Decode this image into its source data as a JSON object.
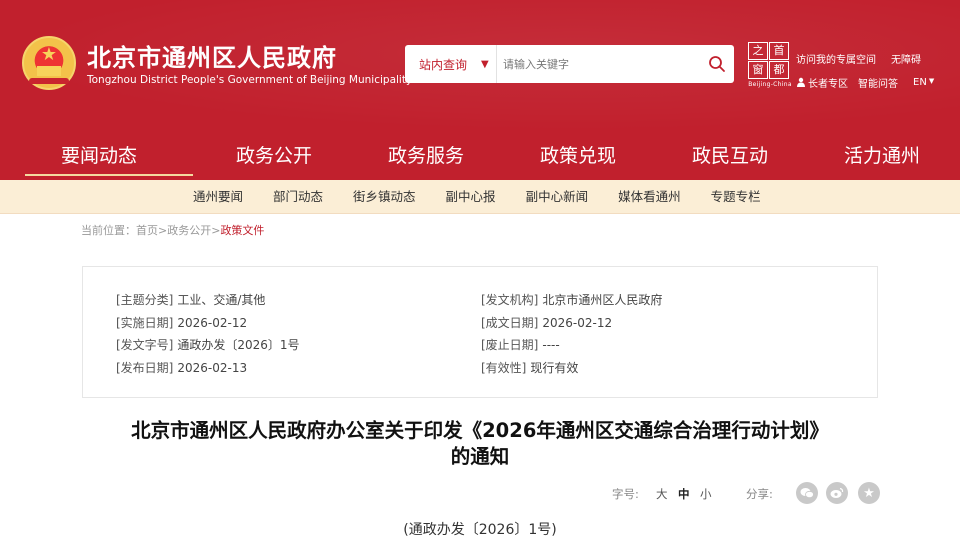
{
  "header": {
    "title": "北京市通州区人民政府",
    "subtitle": "Tongzhou District People's Government of Beijing Municipality",
    "capital_logo": {
      "glyphs": [
        "之",
        "首",
        "窗",
        "都"
      ],
      "caption": "Beijing-China"
    },
    "links": {
      "my_space": "访问我的专属空间",
      "accessible": "无障碍",
      "elder": "长者专区",
      "smart_qa": "智能问答",
      "lang": "EN"
    }
  },
  "search": {
    "scope": "站内查询",
    "placeholder": "请输入关键字"
  },
  "main_nav": {
    "items": [
      "要闻动态",
      "政务公开",
      "政务服务",
      "政策兑现",
      "政民互动",
      "活力通州"
    ],
    "active_index": 0
  },
  "sub_nav": {
    "items": [
      "通州要闻",
      "部门动态",
      "街乡镇动态",
      "副中心报",
      "副中心新闻",
      "媒体看通州",
      "专题专栏"
    ]
  },
  "breadcrumb": {
    "prefix": "当前位置：",
    "home": "首页",
    "sep": ">",
    "level1": "政务公开",
    "current": "政策文件"
  },
  "info": {
    "topic_key": "[主题分类]",
    "topic_val": "工业、交通/其他",
    "issuer_key": "[发文机构]",
    "issuer_val": "北京市通州区人民政府",
    "impl_key": "[实施日期]",
    "impl_val": "2026-02-12",
    "written_key": "[成文日期]",
    "written_val": "2026-02-12",
    "docno_key": "[发文字号]",
    "docno_val": "通政办发〔2026〕1号",
    "repeal_key": "[废止日期]",
    "repeal_val": "----",
    "pub_key": "[发布日期]",
    "pub_val": "2026-02-13",
    "valid_key": "[有效性]",
    "valid_val": "现行有效"
  },
  "article": {
    "title_line1": "北京市通州区人民政府办公室关于印发《2026年通州区交通综合治理行动计划》",
    "title_line2": "的通知",
    "font_label": "字号:",
    "font_large": "大",
    "font_medium": "中",
    "font_small": "小",
    "share_label": "分享:",
    "doc_number": "(通政办发〔2026〕1号)"
  },
  "colors": {
    "brand_red": "#c1202d",
    "subnav_bg": "#fbeed6",
    "share_gray": "#c9c9c9"
  },
  "icons": [
    "emblem-icon",
    "chevron-down-icon",
    "search-icon",
    "person-icon",
    "wechat-icon",
    "weibo-icon",
    "favorite-star-icon"
  ]
}
